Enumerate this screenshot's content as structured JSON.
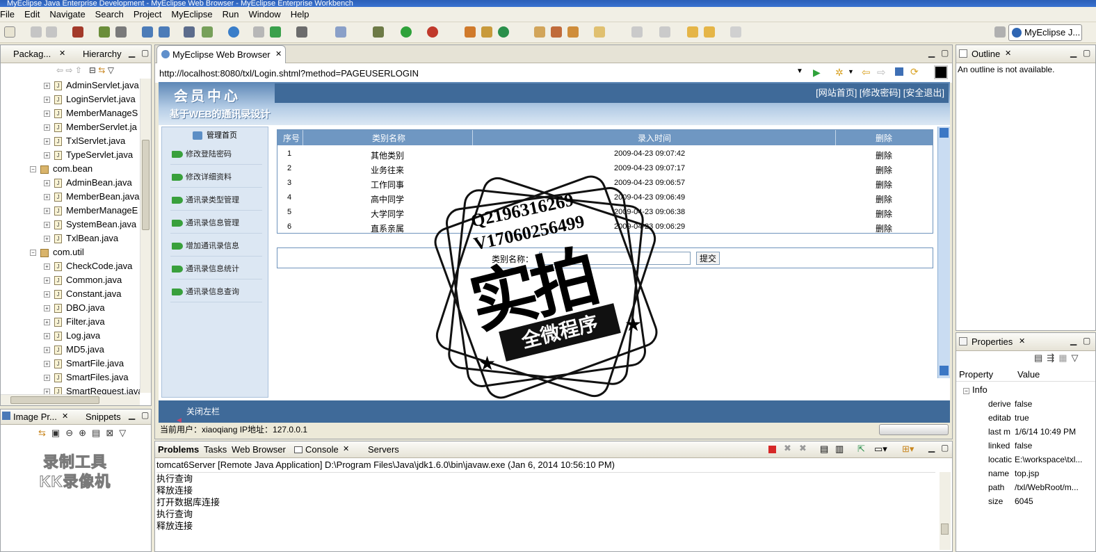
{
  "window": {
    "title": "MyEclipse Java Enterprise Development - MyEclipse Web Browser - MyEclipse Enterprise Workbench"
  },
  "menu": [
    "File",
    "Edit",
    "Navigate",
    "Search",
    "Project",
    "MyEclipse",
    "Run",
    "Window",
    "Help"
  ],
  "perspective": {
    "label": "MyEclipse J..."
  },
  "left_panel": {
    "tabs": [
      "Packag...",
      "Hierarchy"
    ],
    "tree": [
      {
        "label": "AdminServlet.java",
        "kind": "file",
        "indent": 1
      },
      {
        "label": "LoginServlet.java",
        "kind": "file",
        "indent": 1
      },
      {
        "label": "MemberManageS",
        "kind": "file",
        "indent": 1
      },
      {
        "label": "MemberServlet.ja",
        "kind": "file",
        "indent": 1
      },
      {
        "label": "TxlServlet.java",
        "kind": "file",
        "indent": 1
      },
      {
        "label": "TypeServlet.java",
        "kind": "file",
        "indent": 1
      },
      {
        "label": "com.bean",
        "kind": "package",
        "indent": 0
      },
      {
        "label": "AdminBean.java",
        "kind": "file",
        "indent": 1
      },
      {
        "label": "MemberBean.java",
        "kind": "file",
        "indent": 1
      },
      {
        "label": "MemberManageE",
        "kind": "file",
        "indent": 1
      },
      {
        "label": "SystemBean.java",
        "kind": "file",
        "indent": 1
      },
      {
        "label": "TxlBean.java",
        "kind": "file",
        "indent": 1
      },
      {
        "label": "com.util",
        "kind": "package",
        "indent": 0
      },
      {
        "label": "CheckCode.java",
        "kind": "file",
        "indent": 1
      },
      {
        "label": "Common.java",
        "kind": "file",
        "indent": 1
      },
      {
        "label": "Constant.java",
        "kind": "file",
        "indent": 1
      },
      {
        "label": "DBO.java",
        "kind": "file",
        "indent": 1
      },
      {
        "label": "Filter.java",
        "kind": "file",
        "indent": 1
      },
      {
        "label": "Log.java",
        "kind": "file",
        "indent": 1
      },
      {
        "label": "MD5.java",
        "kind": "file",
        "indent": 1
      },
      {
        "label": "SmartFile.java",
        "kind": "file",
        "indent": 1
      },
      {
        "label": "SmartFiles.java",
        "kind": "file",
        "indent": 1
      },
      {
        "label": "SmartRequest.java",
        "kind": "file",
        "indent": 1
      }
    ]
  },
  "bottom_left_panel": {
    "tabs": [
      "Image Pr...",
      "Snippets"
    ],
    "watermark_line1": "录制工具",
    "watermark_line2": "KK录像机"
  },
  "browser": {
    "tab_label": "MyEclipse Web Browser",
    "url": "http://localhost:8080/txl/Login.shtml?method=PAGEUSERLOGIN"
  },
  "webpage": {
    "logo": "会员中心",
    "subtitle": "基于WEB的通讯录设计",
    "top_links": "[网站首页] [修改密码] [安全退出]",
    "home_label": "管理首页",
    "menu": [
      "修改登陆密码",
      "修改详细资料",
      "通讯录类型管理",
      "通讯录信息管理",
      "增加通讯录信息",
      "通讯录信息统计",
      "通讯录信息查询"
    ],
    "table": {
      "headers": [
        "序号",
        "类别名称",
        "录入时间",
        "删除"
      ],
      "rows": [
        [
          "1",
          "其他类别",
          "2009-04-23 09:07:42",
          "删除"
        ],
        [
          "2",
          "业务往来",
          "2009-04-23 09:07:17",
          "删除"
        ],
        [
          "3",
          "工作同事",
          "2009-04-23 09:06:57",
          "删除"
        ],
        [
          "4",
          "高中同学",
          "2009-04-23 09:06:49",
          "删除"
        ],
        [
          "5",
          "大学同学",
          "2009-04-23 09:06:38",
          "删除"
        ],
        [
          "6",
          "直系亲属",
          "2009-04-23 09:06:29",
          "删除"
        ]
      ]
    },
    "form": {
      "label": "类别名称：",
      "value": "",
      "submit": "提交"
    },
    "footer": "关闭左栏",
    "status": "当前用户：xiaoqiang  IP地址：127.0.0.1"
  },
  "outline": {
    "tab": "Outline",
    "message": "An outline is not available."
  },
  "properties": {
    "tab": "Properties",
    "headers": [
      "Property",
      "Value"
    ],
    "group": "Info",
    "rows": [
      [
        "derive",
        "false"
      ],
      [
        "editab",
        "true"
      ],
      [
        "last m",
        "1/6/14 10:49 PM"
      ],
      [
        "linked",
        "false"
      ],
      [
        "locatic",
        "E:\\workspace\\txl..."
      ],
      [
        "name",
        "top.jsp"
      ],
      [
        "path",
        "/txl/WebRoot/m..."
      ],
      [
        "size",
        "6045"
      ]
    ]
  },
  "console": {
    "tabs": [
      "Problems",
      "Tasks",
      "Web Browser",
      "Console",
      "Servers"
    ],
    "header": "tomcat6Server [Remote Java Application] D:\\Program Files\\Java\\jdk1.6.0\\bin\\javaw.exe (Jan 6, 2014 10:56:10 PM)",
    "lines": [
      "执行查询",
      "释放连接",
      "打开数据库连接",
      "执行查询",
      "释放连接"
    ]
  },
  "watermark": {
    "line1": "Q2196316269",
    "line2": "V17060256499",
    "big": "实拍",
    "banner": "全微程序"
  }
}
